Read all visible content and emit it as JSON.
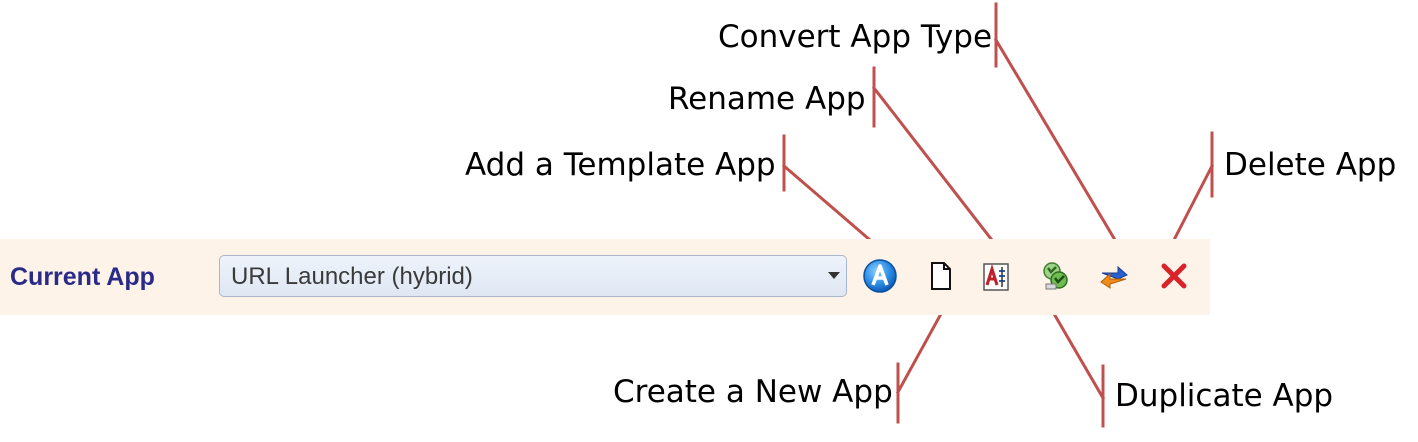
{
  "toolbar": {
    "current_app_label": "Current App",
    "app_select": {
      "value": "URL Launcher (hybrid)"
    },
    "buttons": [
      {
        "name": "add-template-app-button",
        "icon": "template-app-icon"
      },
      {
        "name": "create-new-app-button",
        "icon": "blank-page-icon"
      },
      {
        "name": "rename-app-button",
        "icon": "rename-document-icon"
      },
      {
        "name": "duplicate-app-button",
        "icon": "duplicate-icon"
      },
      {
        "name": "convert-app-type-button",
        "icon": "swap-arrows-icon"
      },
      {
        "name": "delete-app-button",
        "icon": "delete-x-icon"
      }
    ]
  },
  "callouts": {
    "convert_app_type": "Convert App Type",
    "rename_app": "Rename App",
    "add_template_app": "Add a Template App",
    "delete_app": "Delete App",
    "create_new_app": "Create a New App",
    "duplicate_app": "Duplicate App"
  },
  "colors": {
    "toolbar_bg": "#fdf3e8",
    "label_color": "#2a2a88",
    "leader_line": "#c0504d"
  }
}
